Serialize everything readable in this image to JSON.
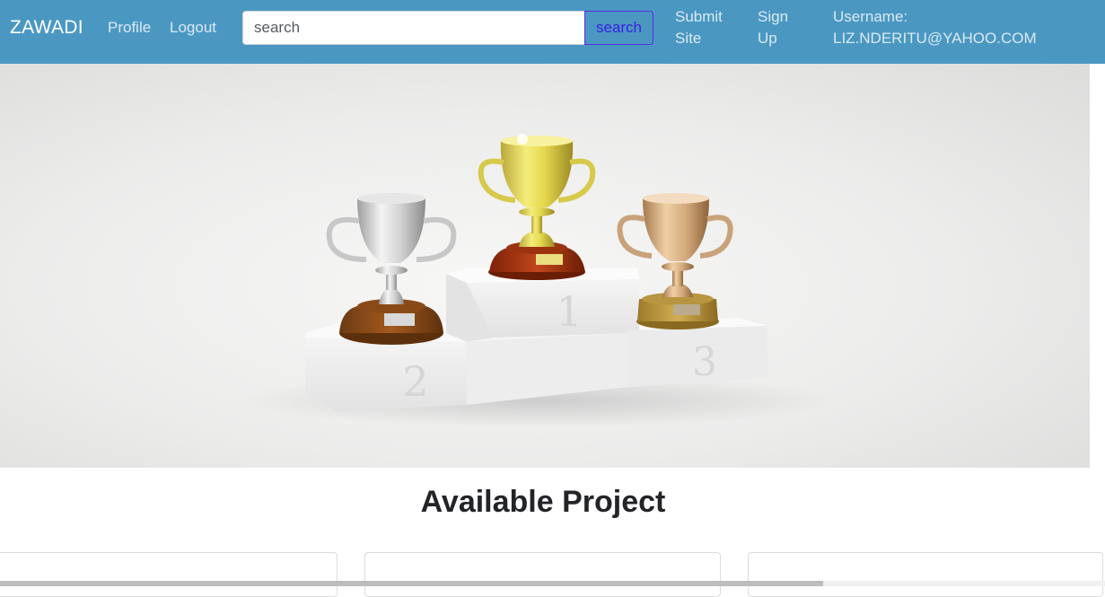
{
  "navbar": {
    "brand": "ZAWADI",
    "links": {
      "profile": "Profile",
      "logout": "Logout",
      "submit_line1": "Submit",
      "submit_line2": "Site",
      "signup_line1": "Sign",
      "signup_line2": "Up",
      "username_label": "Username:",
      "username_value": "LIZ.NDERITU@YAHOO.COM"
    },
    "search": {
      "placeholder": "search",
      "value": "",
      "button_label": "search"
    }
  },
  "hero": {
    "podium_labels": [
      "1",
      "2",
      "3"
    ]
  },
  "main": {
    "heading": "Available Project"
  },
  "colors": {
    "navbar": "#4a98c2",
    "search_button_text": "#3b1ee0",
    "heading": "#222428"
  }
}
